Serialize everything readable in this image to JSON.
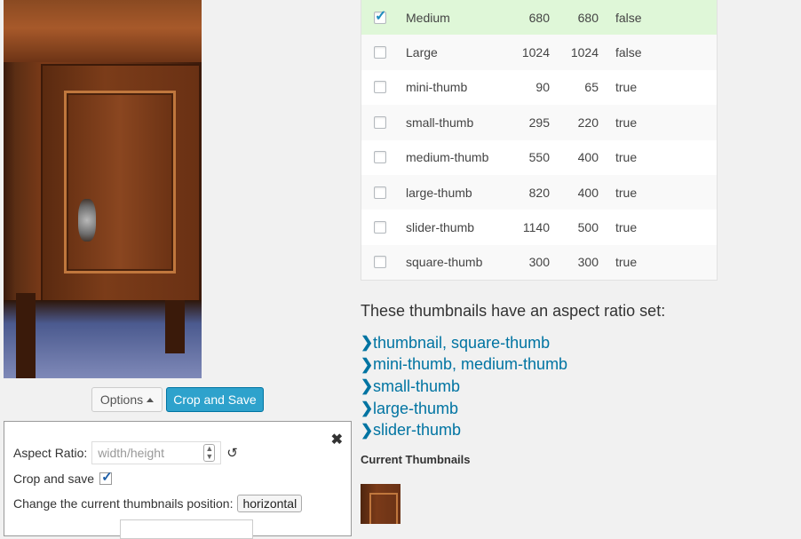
{
  "buttons": {
    "options_label": "Options",
    "crop_save_label": "Crop and Save"
  },
  "options_panel": {
    "aspect_ratio_label": "Aspect Ratio:",
    "aspect_ratio_placeholder": "width/height",
    "crop_and_save_label": "Crop and save",
    "crop_and_save_checked": true,
    "position_label": "Change the current thumbnails position:",
    "position_value": "horizontal"
  },
  "sizes_table": {
    "rows": [
      {
        "checked": true,
        "name": "Medium",
        "width": "680",
        "height": "680",
        "crop": "false"
      },
      {
        "checked": false,
        "name": "Large",
        "width": "1024",
        "height": "1024",
        "crop": "false"
      },
      {
        "checked": false,
        "name": "mini-thumb",
        "width": "90",
        "height": "65",
        "crop": "true"
      },
      {
        "checked": false,
        "name": "small-thumb",
        "width": "295",
        "height": "220",
        "crop": "true"
      },
      {
        "checked": false,
        "name": "medium-thumb",
        "width": "550",
        "height": "400",
        "crop": "true"
      },
      {
        "checked": false,
        "name": "large-thumb",
        "width": "820",
        "height": "400",
        "crop": "true"
      },
      {
        "checked": false,
        "name": "slider-thumb",
        "width": "1140",
        "height": "500",
        "crop": "true"
      },
      {
        "checked": false,
        "name": "square-thumb",
        "width": "300",
        "height": "300",
        "crop": "true"
      }
    ]
  },
  "aspect_section": {
    "title": "These thumbnails have an aspect ratio set:",
    "groups": [
      "thumbnail, square-thumb",
      "mini-thumb, medium-thumb",
      "small-thumb",
      "large-thumb",
      "slider-thumb"
    ]
  },
  "current_thumbnails": {
    "title": "Current Thumbnails"
  },
  "colors": {
    "accent_button": "#2ea2cc",
    "link": "#0074a2",
    "selected_row": "#dff7d8"
  },
  "icons": {
    "close": "close-icon",
    "reset": "reset-icon",
    "chevron": "chevron-right-icon"
  }
}
